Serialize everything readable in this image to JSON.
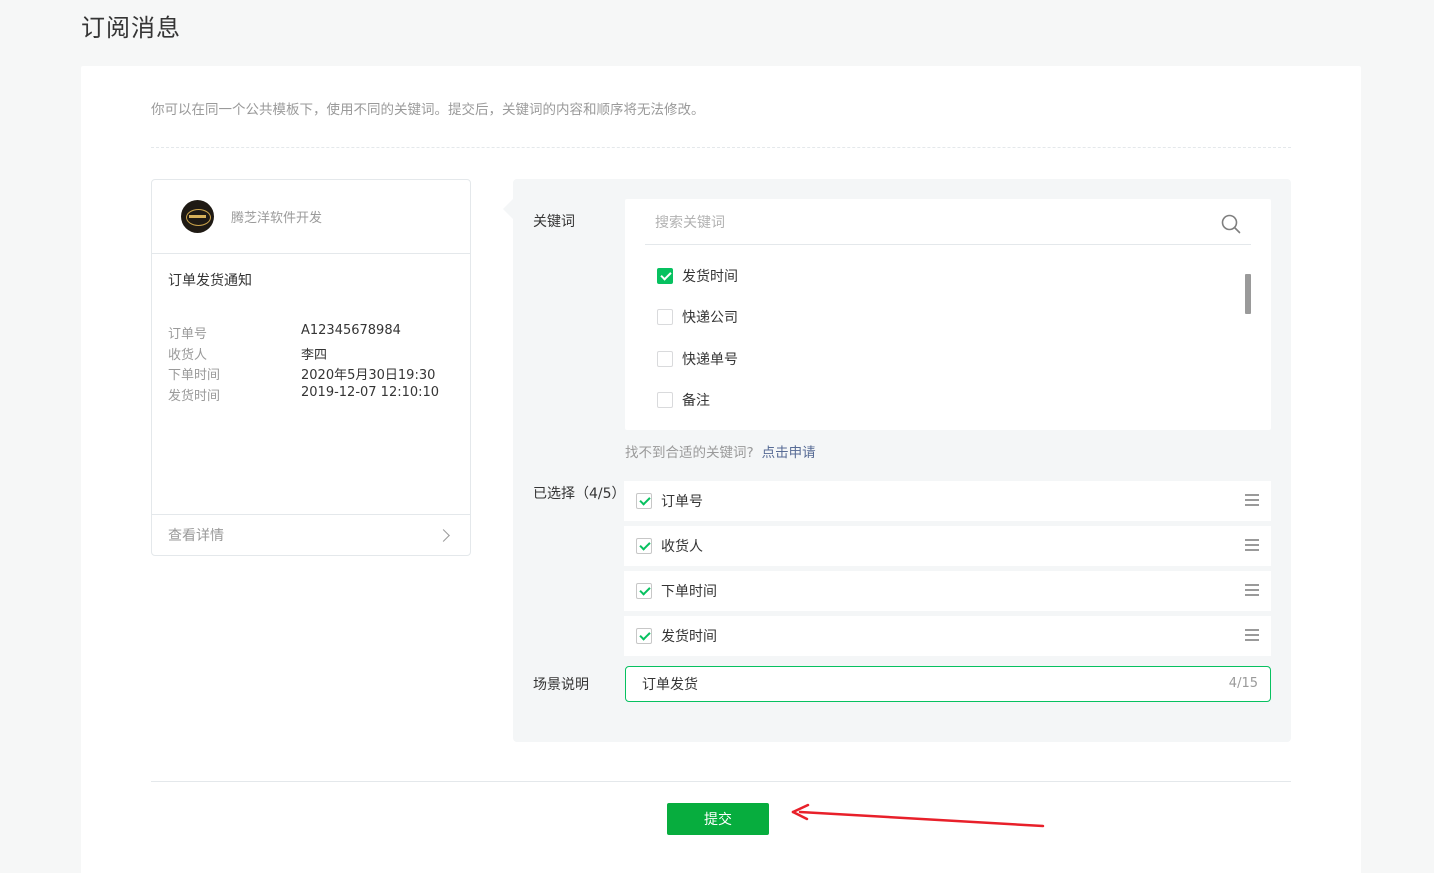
{
  "page": {
    "title": "订阅消息"
  },
  "description": "你可以在同一个公共模板下，使用不同的关键词。提交后，关键词的内容和顺序将无法修改。",
  "preview": {
    "account_name": "腾芝洋软件开发",
    "template_title": "订单发货通知",
    "fields": [
      {
        "key": "订单号",
        "value": "A12345678984"
      },
      {
        "key": "收货人",
        "value": "李四"
      },
      {
        "key": "下单时间",
        "value": "2020年5月30日19:30"
      },
      {
        "key": "发货时间",
        "value": "2019-12-07 12:10:10"
      }
    ],
    "detail_label": "查看详情"
  },
  "keywords": {
    "label": "关键词",
    "search_placeholder": "搜索关键词",
    "search_value": "",
    "items": [
      {
        "label": "发货时间",
        "checked": true
      },
      {
        "label": "快递公司",
        "checked": false
      },
      {
        "label": "快递单号",
        "checked": false
      },
      {
        "label": "备注",
        "checked": false
      }
    ],
    "hint": "找不到合适的关键词?",
    "hint_link": "点击申请"
  },
  "selected": {
    "label": "已选择（4/5）",
    "items": [
      {
        "label": "订单号",
        "checked": true
      },
      {
        "label": "收货人",
        "checked": true
      },
      {
        "label": "下单时间",
        "checked": true
      },
      {
        "label": "发货时间",
        "checked": true
      }
    ]
  },
  "scene": {
    "label": "场景说明",
    "value": "订单发货",
    "counter": "4/15"
  },
  "submit_label": "提交",
  "colors": {
    "accent": "#07c160",
    "button": "#07ad3e",
    "link": "#576b95",
    "annotation": "#e8202a"
  }
}
